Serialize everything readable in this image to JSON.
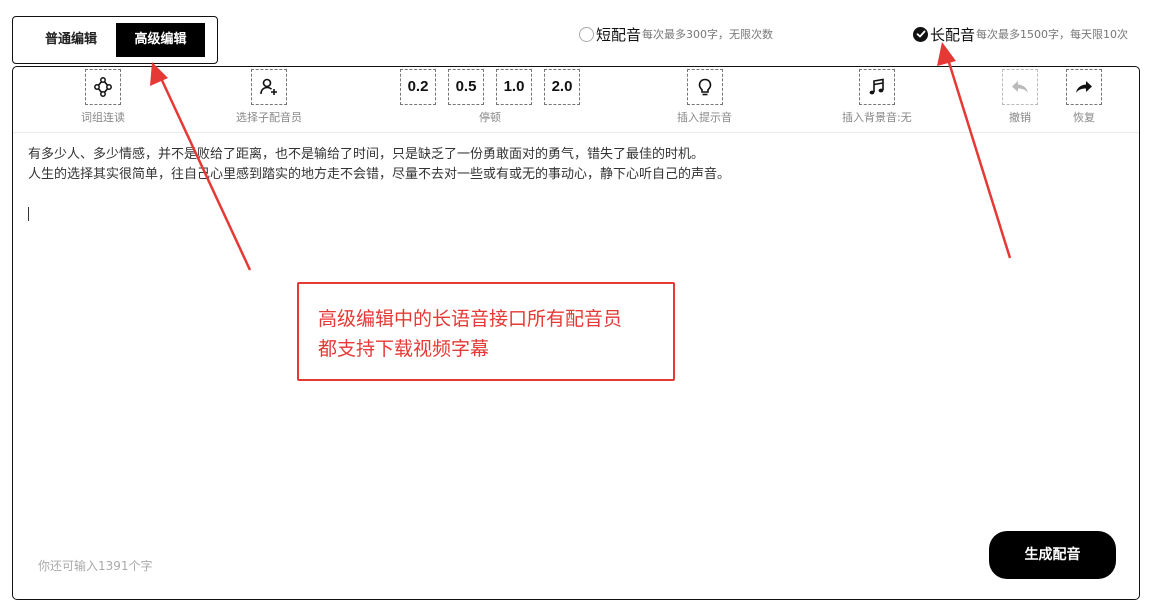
{
  "mode_switch": {
    "normal_label": "普通编辑",
    "advanced_label": "高级编辑",
    "selected": "advanced"
  },
  "voice_options": {
    "short": {
      "name": "短配音",
      "note": "每次最多300字，无限次数",
      "checked": false
    },
    "long": {
      "name": "长配音",
      "note": "每次最多1500字，每天限10次",
      "checked": true
    }
  },
  "toolbar": {
    "word_link_label": "词组连读",
    "sub_voice_label": "选择子配音员",
    "pause_label": "停顿",
    "pause_values": [
      "0.2",
      "0.5",
      "1.0",
      "2.0"
    ],
    "hint_sound_label": "插入提示音",
    "bgm_label": "插入背景音:无",
    "undo_label": "撤销",
    "redo_label": "恢复",
    "icons": [
      "nodes-icon",
      "add-user-icon",
      "bulb-icon",
      "music-note-icon",
      "undo-icon",
      "redo-icon"
    ]
  },
  "editor": {
    "lines": [
      "有多少人、多少情感，并不是败给了距离，也不是输给了时间，只是缺乏了一份勇敢面对的勇气，错失了最佳的时机。",
      "人生的选择其实很简单，往自己心里感到踏实的地方走不会错，尽量不去对一些或有或无的事动心，静下心听自己的声音。"
    ]
  },
  "footer": {
    "counter_text": "你还可输入1391个字",
    "generate_label": "生成配音"
  },
  "annotation": {
    "line1": "高级编辑中的长语音接口所有配音员",
    "line2": "都支持下载视频字幕",
    "color": "#e53935"
  },
  "colors": {
    "primary": "#000000",
    "muted": "#888888",
    "annotation": "#e53935"
  }
}
